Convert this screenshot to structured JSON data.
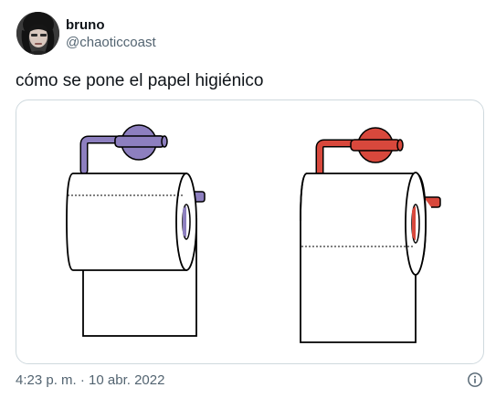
{
  "user": {
    "display_name": "bruno",
    "handle": "@chaoticcoast",
    "avatar_icon": "profile-photo"
  },
  "tweet": {
    "text": "cómo se pone el papel higiénico"
  },
  "media": {
    "left_holder_color": "#8d7fbf",
    "right_holder_color": "#d8483c"
  },
  "footer": {
    "timestamp": "4:23 p. m. · 10 abr. 2022",
    "info_icon": "info-icon"
  }
}
